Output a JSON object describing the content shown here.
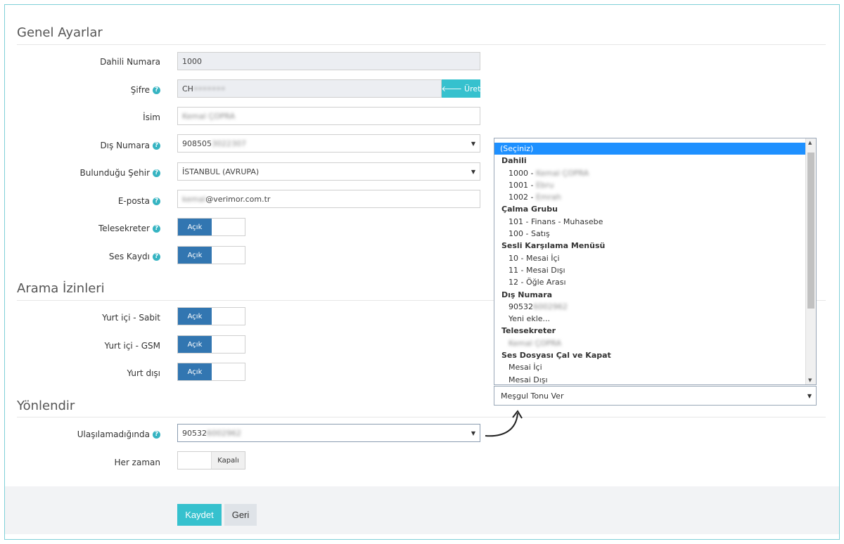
{
  "sections": {
    "general": "Genel Ayarlar",
    "call_permissions": "Arama İzinleri",
    "redirect": "Yönlendir"
  },
  "fields": {
    "extension": {
      "label": "Dahili Numara",
      "value": "1000"
    },
    "password": {
      "label": "Şifre",
      "value_visible": "CH",
      "value_blurred": "•••••••",
      "generate_label": "Üret"
    },
    "name": {
      "label": "İsim",
      "value": "Kemal ÇOPRA"
    },
    "external_number": {
      "label": "Dış Numara",
      "value_visible": "908505",
      "value_blurred": "3022307"
    },
    "city": {
      "label": "Bulunduğu Şehir",
      "value": "İSTANBUL (AVRUPA)"
    },
    "email": {
      "label": "E-posta",
      "value_blurred": "kemal",
      "value_visible": "@verimor.com.tr"
    },
    "voicemail": {
      "label": "Telesekreter",
      "state": "Açık"
    },
    "recording": {
      "label": "Ses Kaydı",
      "state": "Açık"
    },
    "domestic_landline": {
      "label": "Yurt içi - Sabit",
      "state": "Açık"
    },
    "domestic_mobile": {
      "label": "Yurt içi - GSM",
      "state": "Açık"
    },
    "international": {
      "label": "Yurt dışı",
      "state": "Açık"
    },
    "unreachable": {
      "label": "Ulaşılamadığında",
      "value_visible": "90532",
      "value_blurred": "6002962"
    },
    "always": {
      "label": "Her zaman",
      "state": "Kapalı"
    }
  },
  "dropdown": {
    "items": [
      {
        "type": "selected",
        "text": "(Seçiniz)"
      },
      {
        "type": "group",
        "text": "Dahili"
      },
      {
        "type": "option",
        "text": "1000 - ",
        "blurred": "Kemal ÇOPRA"
      },
      {
        "type": "option",
        "text": "1001 - ",
        "blurred": "Ebru"
      },
      {
        "type": "option",
        "text": "1002 - ",
        "blurred": "Emrah"
      },
      {
        "type": "group",
        "text": "Çalma Grubu"
      },
      {
        "type": "option",
        "text": "101 - Finans - Muhasebe"
      },
      {
        "type": "option",
        "text": "100 - Satış"
      },
      {
        "type": "group",
        "text": "Sesli Karşılama Menüsü"
      },
      {
        "type": "option",
        "text": "10 - Mesai İçi"
      },
      {
        "type": "option",
        "text": "11 - Mesai Dışı"
      },
      {
        "type": "option",
        "text": "12 - Öğle Arası"
      },
      {
        "type": "group",
        "text": "Dış Numara"
      },
      {
        "type": "option",
        "text": "90532",
        "blurred": "6002962"
      },
      {
        "type": "option",
        "text": "Yeni ekle..."
      },
      {
        "type": "group",
        "text": "Telesekreter"
      },
      {
        "type": "option",
        "text": "",
        "blurred": "Kemal ÇOPRA"
      },
      {
        "type": "group",
        "text": "Ses Dosyası Çal ve Kapat"
      },
      {
        "type": "option",
        "text": "Mesai İçi"
      },
      {
        "type": "option",
        "text": "Mesai Dışı"
      }
    ],
    "selected_value": "Meşgul Tonu Ver"
  },
  "buttons": {
    "save": "Kaydet",
    "back": "Geri"
  },
  "colors": {
    "accent": "#36c1ce",
    "toggle_on": "#3276b1",
    "help": "#36b4c2"
  }
}
